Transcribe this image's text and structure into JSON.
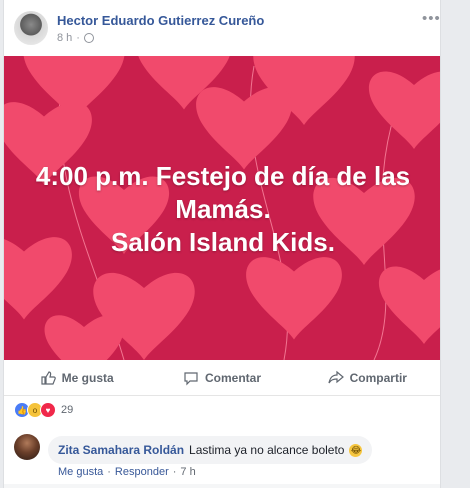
{
  "post": {
    "author": "Hector Eduardo Gutierrez Cureño",
    "time": "8 h",
    "separator": "·",
    "more_icon": "ellipsis-icon",
    "image_text": {
      "line1": "4:00 p.m. Festejo de día de las",
      "line2": "Mamás.",
      "line3": "Salón Island Kids."
    },
    "image_background": "#c91f4c",
    "heart_color": "#f24a6a"
  },
  "actions": {
    "like": "Me gusta",
    "comment": "Comentar",
    "share": "Compartir"
  },
  "reactions": {
    "count": "29",
    "types": [
      "like-icon",
      "wow-icon",
      "love-icon"
    ]
  },
  "comment": {
    "author": "Zita Samahara Roldán",
    "text": "Lastima ya no alcance boleto",
    "emoji": "laughing-emoji",
    "like_link": "Me gusta",
    "reply_link": "Responder",
    "dot": "·",
    "time": "7 h"
  },
  "colors": {
    "link_blue": "#365899",
    "meta_gray": "#90949c",
    "action_gray": "#606770"
  }
}
